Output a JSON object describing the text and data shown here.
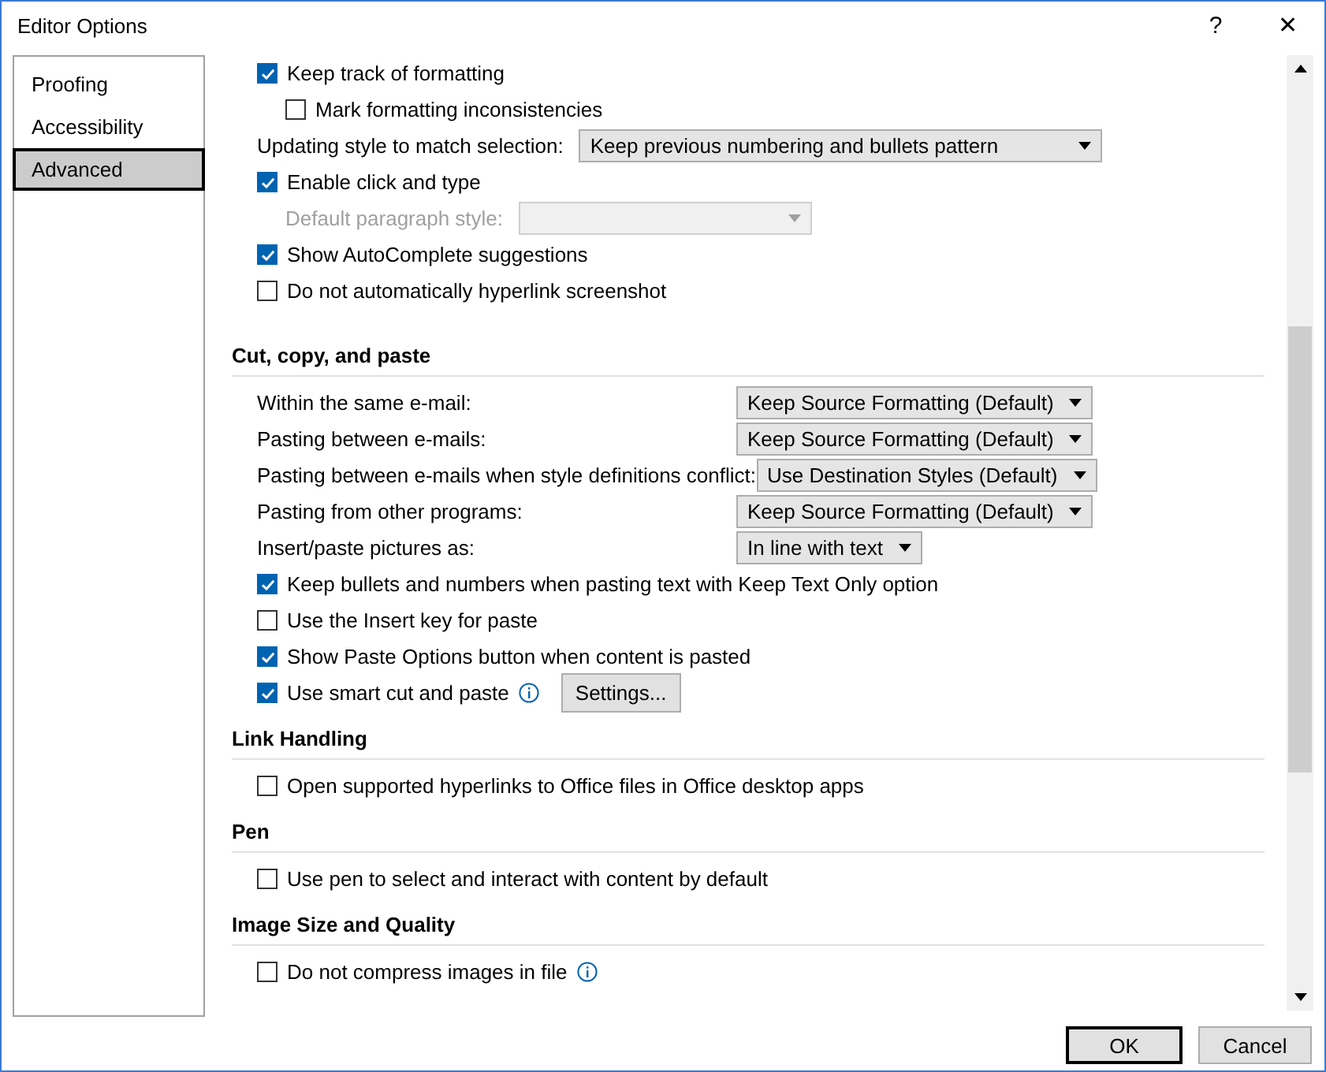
{
  "window": {
    "title": "Editor Options",
    "help": "?",
    "close": "✕"
  },
  "sidebar": {
    "items": [
      {
        "label": "Proofing",
        "selected": false
      },
      {
        "label": "Accessibility",
        "selected": false
      },
      {
        "label": "Advanced",
        "selected": true
      }
    ]
  },
  "sections": [
    {
      "items": [
        {
          "kind": "checkbox",
          "label": "Keep track of formatting",
          "checked": true,
          "children": [
            {
              "kind": "checkbox",
              "label": "Mark formatting inconsistencies",
              "checked": false
            }
          ]
        },
        {
          "kind": "select",
          "label": "Updating style to match selection:",
          "value": "Keep previous numbering and bullets pattern",
          "disabled": false
        },
        {
          "kind": "checkbox",
          "label": "Enable click and type",
          "checked": true,
          "children": [
            {
              "kind": "select",
              "label": "Default paragraph style:",
              "disabled": true
            }
          ]
        },
        {
          "kind": "checkbox",
          "label": "Show AutoComplete suggestions",
          "checked": true
        },
        {
          "kind": "checkbox",
          "label": "Do not automatically hyperlink screenshot",
          "checked": false
        }
      ]
    },
    {
      "heading": "Cut, copy, and paste",
      "items": [
        {
          "kind": "select",
          "label": "Within the same e-mail:",
          "value": "Keep Source Formatting (Default)",
          "disabled": false
        },
        {
          "kind": "select",
          "label": "Pasting between e-mails:",
          "value": "Keep Source Formatting (Default)",
          "disabled": false
        },
        {
          "kind": "select",
          "label": "Pasting between e-mails when style definitions conflict:",
          "value": "Use Destination Styles (Default)",
          "disabled": false
        },
        {
          "kind": "select",
          "label": "Pasting from other programs:",
          "value": "Keep Source Formatting (Default)",
          "disabled": false
        },
        {
          "kind": "select",
          "label": "Insert/paste pictures as:",
          "value": "In line with text",
          "disabled": false
        },
        {
          "kind": "checkbox",
          "label": "Keep bullets and numbers when pasting text with Keep Text Only option",
          "checked": true
        },
        {
          "kind": "checkbox",
          "label": "Use the Insert key for paste",
          "checked": false
        },
        {
          "kind": "checkbox",
          "label": "Show Paste Options button when content is pasted",
          "checked": true
        },
        {
          "kind": "checkbox",
          "label": "Use smart cut and paste",
          "checked": true,
          "info": true,
          "button": "Settings..."
        }
      ]
    },
    {
      "heading": "Link Handling",
      "items": [
        {
          "kind": "checkbox",
          "label": "Open supported hyperlinks to Office files in Office desktop apps",
          "checked": false
        }
      ]
    },
    {
      "heading": "Pen",
      "items": [
        {
          "kind": "checkbox",
          "label": "Use pen to select and interact with content by default",
          "checked": false
        }
      ]
    },
    {
      "heading": "Image Size and Quality",
      "items": [
        {
          "kind": "checkbox",
          "label": "Do not compress images in file",
          "checked": false,
          "info": true
        }
      ]
    }
  ],
  "buttons": [
    {
      "label": "OK",
      "default": true
    },
    {
      "label": "Cancel",
      "default": false
    }
  ]
}
